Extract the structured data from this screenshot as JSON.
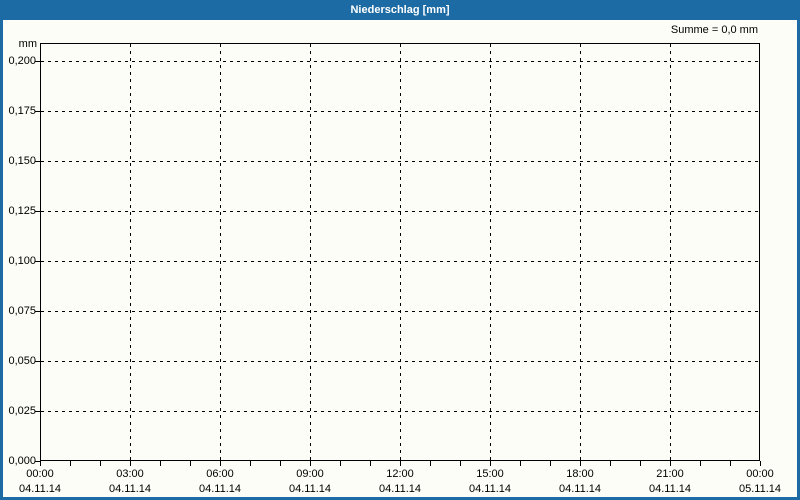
{
  "window": {
    "title": "Niederschlag [mm]"
  },
  "summary": {
    "text": "Summe = 0,0 mm"
  },
  "chart_data": {
    "type": "bar",
    "title": "Niederschlag [mm]",
    "xlabel": "",
    "ylabel": "mm",
    "ylim": [
      0.0,
      0.2
    ],
    "y_tick_step": 0.025,
    "y_tick_labels": [
      "0,200",
      "0,175",
      "0,150",
      "0,125",
      "0,100",
      "0,075",
      "0,050",
      "0,025",
      "0,000"
    ],
    "x_ticks": [
      {
        "time": "00:00",
        "date": "04.11.14"
      },
      {
        "time": "03:00",
        "date": "04.11.14"
      },
      {
        "time": "06:00",
        "date": "04.11.14"
      },
      {
        "time": "09:00",
        "date": "04.11.14"
      },
      {
        "time": "12:00",
        "date": "04.11.14"
      },
      {
        "time": "15:00",
        "date": "04.11.14"
      },
      {
        "time": "18:00",
        "date": "04.11.14"
      },
      {
        "time": "21:00",
        "date": "04.11.14"
      },
      {
        "time": "00:00",
        "date": "05.11.14"
      }
    ],
    "x_minor_tick_interval": "1h",
    "x_major_tick_interval": "3h",
    "series": [
      {
        "name": "Niederschlag",
        "values": [
          0,
          0,
          0,
          0,
          0,
          0,
          0,
          0,
          0
        ]
      }
    ],
    "sum_annotation": "Summe = 0,0 mm",
    "grid": "dashed",
    "legend_position": "none"
  },
  "colors": {
    "titlebar_blue": "#1c6ba5",
    "background": "#fdfdf8",
    "grid_black": "#000000",
    "title_text": "#ffffff"
  }
}
